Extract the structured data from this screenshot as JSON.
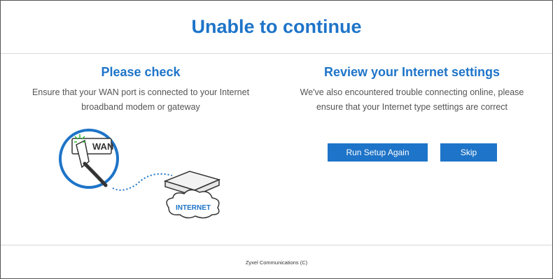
{
  "header": {
    "title": "Unable to continue"
  },
  "left": {
    "title": "Please check",
    "line1": "Ensure that your WAN port is connected to your Internet",
    "line2": "broadband modem or gateway",
    "wan_label": "WAN",
    "internet_label": "INTERNET"
  },
  "right": {
    "title": "Review your Internet settings",
    "line1": "We've also encountered trouble connecting online, please",
    "line2": "ensure that your Internet type settings are correct"
  },
  "buttons": {
    "run_setup": "Run Setup Again",
    "skip": "Skip"
  },
  "footer": {
    "text": "Zyxel Communications (C)"
  },
  "colors": {
    "accent": "#1e74c8",
    "led": "#2db82d"
  }
}
